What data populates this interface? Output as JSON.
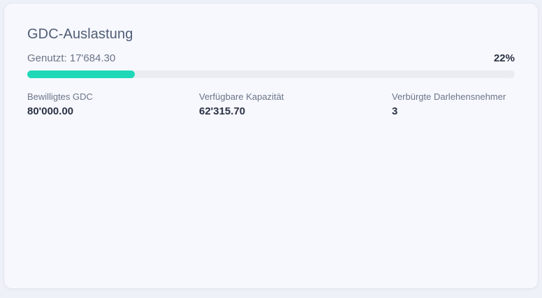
{
  "card": {
    "title": "GDC-Auslastung",
    "used_label": "Genutzt: 17'684.30",
    "percent_label": "22%",
    "progress_fraction": 0.22,
    "accent_color": "#1fd8b8"
  },
  "stats": [
    {
      "label": "Bewilligtes GDC",
      "value": "80'000.00"
    },
    {
      "label": "Verfügbare Kapazität",
      "value": "62'315.70"
    },
    {
      "label": "Verbürgte Darlehensnehmer",
      "value": "3"
    }
  ]
}
